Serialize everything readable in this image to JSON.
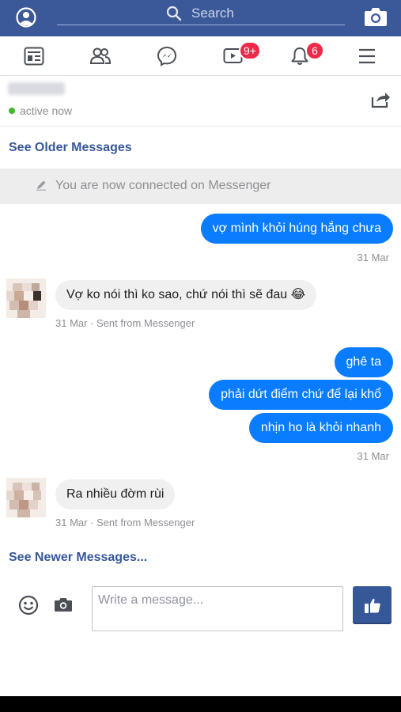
{
  "header": {
    "search_placeholder": "Search",
    "profile_icon": "profile-icon",
    "camera_icon": "camera-icon"
  },
  "nav": {
    "items": [
      {
        "name": "news-feed",
        "icon": "news-feed-icon"
      },
      {
        "name": "friends",
        "icon": "friends-icon"
      },
      {
        "name": "messenger",
        "icon": "messenger-icon"
      },
      {
        "name": "watch",
        "icon": "video-icon",
        "badge": "9+"
      },
      {
        "name": "notifications",
        "icon": "bell-icon",
        "badge": "6"
      },
      {
        "name": "menu",
        "icon": "hamburger-menu-icon"
      }
    ]
  },
  "chat": {
    "status": "active now",
    "see_older": "See Older Messages",
    "connected_notice": "You are now connected on Messenger",
    "see_newer": "See Newer Messages...",
    "messages": {
      "m1": {
        "text": "vợ mình khỏi húng hắng chưa",
        "time": "31 Mar"
      },
      "m2": {
        "text": "Vợ ko nói thì ko sao, chứ nói thì sẽ đau 😂",
        "meta": "31 Mar · Sent from Messenger"
      },
      "m3": {
        "text": "ghê ta"
      },
      "m4": {
        "text": "phải dứt điểm chứ để lại khổ"
      },
      "m5": {
        "text": "nhịn ho là khỏi nhanh",
        "time": "31 Mar"
      },
      "m6": {
        "text": "Ra nhiều đờm rùi",
        "meta": "31 Mar · Sent from Messenger"
      }
    }
  },
  "composer": {
    "placeholder": "Write a message...",
    "emoji_icon": "emoji-icon",
    "camera_icon": "camera-icon",
    "like_icon": "thumbs-up-icon"
  },
  "colors": {
    "brand": "#3b5998",
    "link": "#365899",
    "outgoing_bubble": "#0a7cff",
    "incoming_bubble": "#f1f0f0",
    "badge": "#f02849",
    "online": "#42b72a"
  }
}
